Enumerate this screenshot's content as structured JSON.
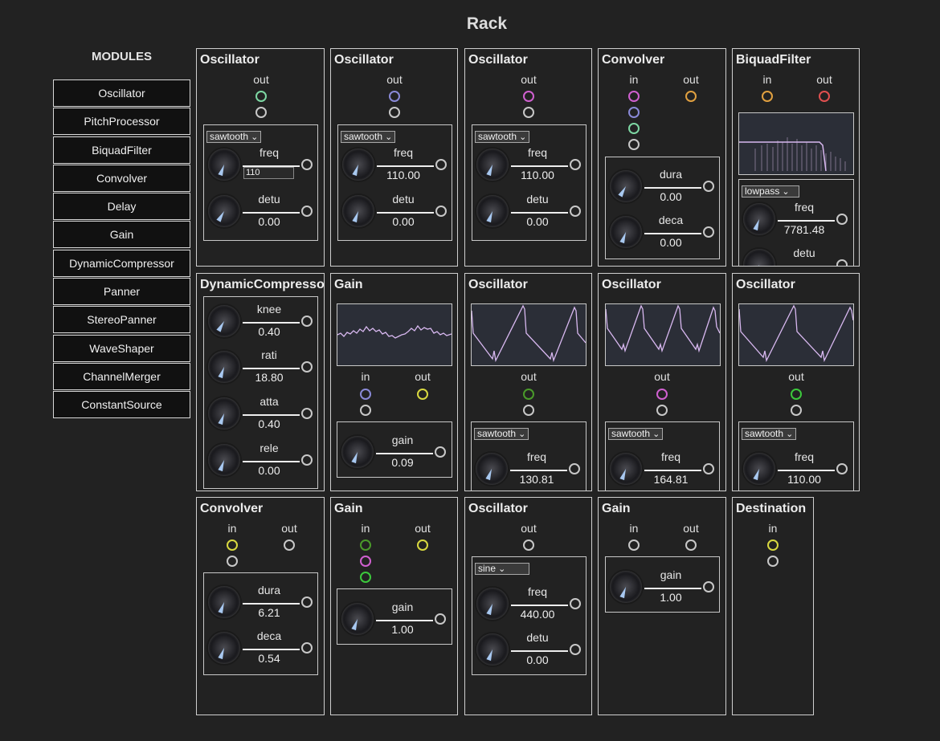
{
  "page": {
    "title": "Rack",
    "sidebar_title": "MODULES"
  },
  "modules": [
    "Oscillator",
    "PitchProcessor",
    "BiquadFilter",
    "Convolver",
    "Delay",
    "Gain",
    "DynamicCompressor",
    "Panner",
    "StereoPanner",
    "WaveShaper",
    "ChannelMerger",
    "ConstantSource"
  ],
  "port_labels": {
    "in": "in",
    "out": "out"
  },
  "colors": {
    "background": "#222222",
    "knob_pointer": "#a8c8f0",
    "waveform": "#d8b8f0",
    "port_green": "#7dd7a3",
    "port_blue": "#8a8ad8",
    "port_magenta": "#d060d0",
    "port_orange": "#e0a040",
    "port_red": "#e05050",
    "port_yellow": "#d8d840",
    "port_dark_green": "#4a9a2a",
    "port_lime": "#3cc83c"
  },
  "nodes": [
    {
      "title": "Oscillator",
      "waveform": "sawtooth",
      "params": [
        {
          "name": "freq",
          "value": "110",
          "editing": true
        },
        {
          "name": "detu",
          "value": "0.00"
        }
      ]
    },
    {
      "title": "Oscillator",
      "waveform": "sawtooth",
      "params": [
        {
          "name": "freq",
          "value": "110.00"
        },
        {
          "name": "detu",
          "value": "0.00"
        }
      ]
    },
    {
      "title": "Oscillator",
      "waveform": "sawtooth",
      "params": [
        {
          "name": "freq",
          "value": "110.00"
        },
        {
          "name": "detu",
          "value": "0.00"
        }
      ]
    },
    {
      "title": "Convolver",
      "params": [
        {
          "name": "dura",
          "value": "0.00"
        },
        {
          "name": "deca",
          "value": "0.00"
        }
      ]
    },
    {
      "title": "BiquadFilter",
      "filter_type": "lowpass",
      "params": [
        {
          "name": "freq",
          "value": "7781.48"
        },
        {
          "name": "detu",
          "value": ""
        }
      ]
    },
    {
      "title": "DynamicCompressor",
      "params": [
        {
          "name": "knee",
          "value": "0.40"
        },
        {
          "name": "rati",
          "value": "18.80"
        },
        {
          "name": "atta",
          "value": "0.40"
        },
        {
          "name": "rele",
          "value": "0.00"
        }
      ]
    },
    {
      "title": "Gain",
      "params": [
        {
          "name": "gain",
          "value": "0.09"
        }
      ]
    },
    {
      "title": "Oscillator",
      "waveform": "sawtooth",
      "params": [
        {
          "name": "freq",
          "value": "130.81"
        }
      ]
    },
    {
      "title": "Oscillator",
      "waveform": "sawtooth",
      "params": [
        {
          "name": "freq",
          "value": "164.81"
        }
      ]
    },
    {
      "title": "Oscillator",
      "waveform": "sawtooth",
      "params": [
        {
          "name": "freq",
          "value": "110.00"
        }
      ]
    },
    {
      "title": "Convolver",
      "params": [
        {
          "name": "dura",
          "value": "6.21"
        },
        {
          "name": "deca",
          "value": "0.54"
        }
      ]
    },
    {
      "title": "Gain",
      "params": [
        {
          "name": "gain",
          "value": "1.00"
        }
      ]
    },
    {
      "title": "Oscillator",
      "waveform": "sine",
      "params": [
        {
          "name": "freq",
          "value": "440.00"
        },
        {
          "name": "detu",
          "value": "0.00"
        }
      ]
    },
    {
      "title": "Gain",
      "params": [
        {
          "name": "gain",
          "value": "1.00"
        }
      ]
    },
    {
      "title": "Destination",
      "params": []
    }
  ]
}
